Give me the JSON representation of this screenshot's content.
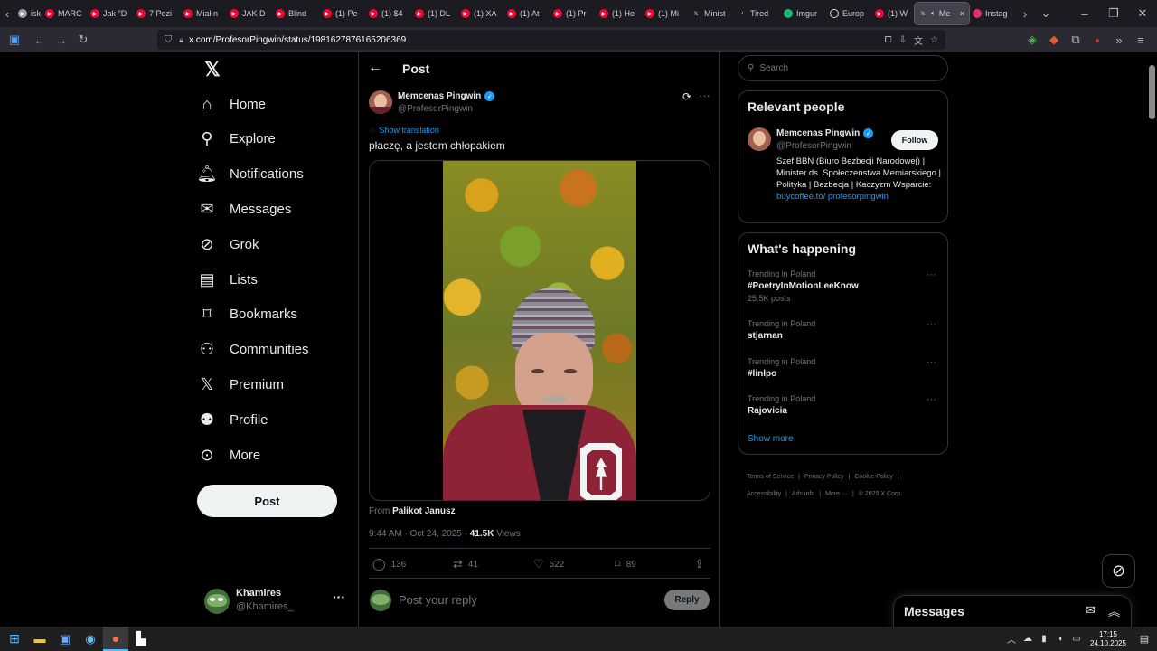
{
  "browser": {
    "tabs": [
      {
        "label": "isk",
        "color": "#9aa0a6",
        "icon": "youtube-icon"
      },
      {
        "label": "MARC",
        "color": "#ff0033",
        "icon": "youtube-icon"
      },
      {
        "label": "Jak \"D",
        "color": "#ff0033",
        "icon": "youtube-icon"
      },
      {
        "label": "7 Pozi",
        "color": "#ff0033",
        "icon": "youtube-icon"
      },
      {
        "label": "Miał n",
        "color": "#ff0033",
        "icon": "youtube-icon"
      },
      {
        "label": "JAK D",
        "color": "#ff0033",
        "icon": "youtube-icon"
      },
      {
        "label": "Blind",
        "color": "#ff0033",
        "icon": "youtube-icon"
      },
      {
        "label": "(1) Pe",
        "color": "#ff0033",
        "icon": "youtube-icon"
      },
      {
        "label": "(1) $4",
        "color": "#ff0033",
        "icon": "youtube-icon"
      },
      {
        "label": "(1) DL",
        "color": "#ff0033",
        "icon": "youtube-icon"
      },
      {
        "label": "(1) XA",
        "color": "#ff0033",
        "icon": "youtube-icon"
      },
      {
        "label": "(1) At",
        "color": "#ff0033",
        "icon": "youtube-icon"
      },
      {
        "label": "(1) Pr",
        "color": "#ff0033",
        "icon": "youtube-icon"
      },
      {
        "label": "(1) Ho",
        "color": "#ff0033",
        "icon": "youtube-icon"
      },
      {
        "label": "(1) Mi",
        "color": "#ff0033",
        "icon": "youtube-icon"
      },
      {
        "label": "Minist",
        "color": "#ffffff",
        "icon": "x-icon"
      },
      {
        "label": "Tired",
        "color": "#ffffff",
        "icon": "tiktok-icon"
      },
      {
        "label": "Imgur",
        "color": "#1bb76e",
        "icon": "imgur-icon"
      },
      {
        "label": "Europ",
        "color": "#ffffff",
        "icon": "globe-icon"
      },
      {
        "label": "(1) W",
        "color": "#ff0033",
        "icon": "youtube-icon"
      },
      {
        "label": "Me",
        "color": "#ffffff",
        "icon": "x-icon",
        "active": true
      },
      {
        "label": "Instag",
        "color": "#e1306c",
        "icon": "instagram-icon"
      }
    ],
    "url": "x.com/ProfesorPingwin/status/1981627876165206369"
  },
  "sidebar": {
    "items": [
      {
        "label": "Home",
        "icon": "home-icon"
      },
      {
        "label": "Explore",
        "icon": "search-icon"
      },
      {
        "label": "Notifications",
        "icon": "bell-icon"
      },
      {
        "label": "Messages",
        "icon": "envelope-icon"
      },
      {
        "label": "Grok",
        "icon": "grok-icon"
      },
      {
        "label": "Lists",
        "icon": "list-icon"
      },
      {
        "label": "Bookmarks",
        "icon": "bookmark-icon"
      },
      {
        "label": "Communities",
        "icon": "people-icon"
      },
      {
        "label": "Premium",
        "icon": "x-logo-icon"
      },
      {
        "label": "Profile",
        "icon": "person-icon"
      },
      {
        "label": "More",
        "icon": "more-circle-icon"
      }
    ],
    "post_button": "Post",
    "account": {
      "name": "Khamires",
      "handle": "@Khamires_"
    }
  },
  "post": {
    "header_title": "Post",
    "author_name": "Memcenas Pingwin",
    "author_handle": "@ProfesorPingwin",
    "show_translation": "Show translation",
    "text": "płaczę, a jestem chłopakiem",
    "from_label": "From",
    "from_name": "Palikot Janusz",
    "timestamp": "9:44 AM · Oct 24, 2025 ·",
    "views_count": "41.5K",
    "views_label": "Views",
    "stats": {
      "replies": "136",
      "reposts": "41",
      "likes": "522",
      "bookmarks": "89"
    },
    "reply_placeholder": "Post your reply",
    "reply_button": "Reply"
  },
  "right": {
    "search_placeholder": "Search",
    "relevant_title": "Relevant people",
    "person": {
      "name": "Memcenas Pingwin",
      "handle": "@ProfesorPingwin",
      "follow": "Follow",
      "bio": "Szef BBN (Biuro Bezbecji Narodowej) | Minister ds. Społeczeństwa Memiarskiego | Polityka | Bezbecja | Kaczyzm Wsparcie: ",
      "bio_link": "buycoffee.to/ profesorpingwin"
    },
    "happening_title": "What's happening",
    "trends": [
      {
        "meta": "Trending in Poland",
        "name": "#PoetryInMotionLeeKnow",
        "posts": "25.5K posts"
      },
      {
        "meta": "Trending in Poland",
        "name": "stjarnan",
        "posts": ""
      },
      {
        "meta": "Trending in Poland",
        "name": "#linlpo",
        "posts": ""
      },
      {
        "meta": "Trending in Poland",
        "name": "Rajovicia",
        "posts": ""
      }
    ],
    "show_more": "Show more",
    "footer": [
      "Terms of Service",
      "Privacy Policy",
      "Cookie Policy",
      "Accessibility",
      "Ads info",
      "More ···",
      "© 2025 X Corp."
    ],
    "messages_title": "Messages"
  },
  "taskbar": {
    "time": "17:15",
    "date": "24.10.2025"
  },
  "colors": {
    "accent": "#1d9bf0",
    "background": "#000000",
    "border": "#2f3336"
  }
}
